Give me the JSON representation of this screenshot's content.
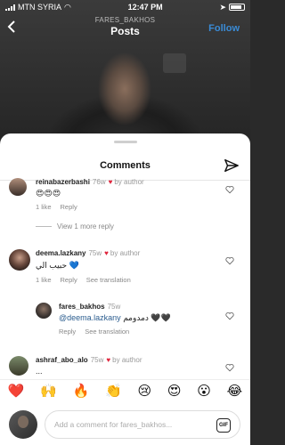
{
  "status_bar": {
    "carrier": "MTN SYRIA",
    "time": "12:47 PM"
  },
  "header": {
    "username": "FARES_BAKHOS",
    "title": "Posts",
    "follow_label": "Follow"
  },
  "sheet": {
    "title": "Comments"
  },
  "comments": [
    {
      "username": "reinabazerbashi",
      "time": "76w",
      "by_author": "by author",
      "text": "😍😍😍",
      "likes": "1 like",
      "reply": "Reply"
    },
    {
      "username": "deema.lazkany",
      "time": "75w",
      "by_author": "by author",
      "text": "حبيب الي 💙",
      "likes": "1 like",
      "reply": "Reply",
      "see_translation": "See translation"
    },
    {
      "username": "ashraf_abo_alo",
      "time": "75w",
      "by_author": "by author",
      "text": "..."
    }
  ],
  "view_more": "View 1 more reply",
  "reply": {
    "username": "fares_bakhos",
    "time": "75w",
    "mention": "@deema.lazkany",
    "text": "دمدومم 🖤🖤",
    "reply": "Reply",
    "see_translation": "See translation"
  },
  "reactions": [
    "❤️",
    "🙌",
    "🔥",
    "👏",
    "😢",
    "😍",
    "😮",
    "😂"
  ],
  "composer": {
    "placeholder": "Add a comment for fares_bakhos...",
    "gif_label": "GIF"
  },
  "colors": {
    "accent": "#3a8bd6",
    "heart": "#e0243c"
  }
}
